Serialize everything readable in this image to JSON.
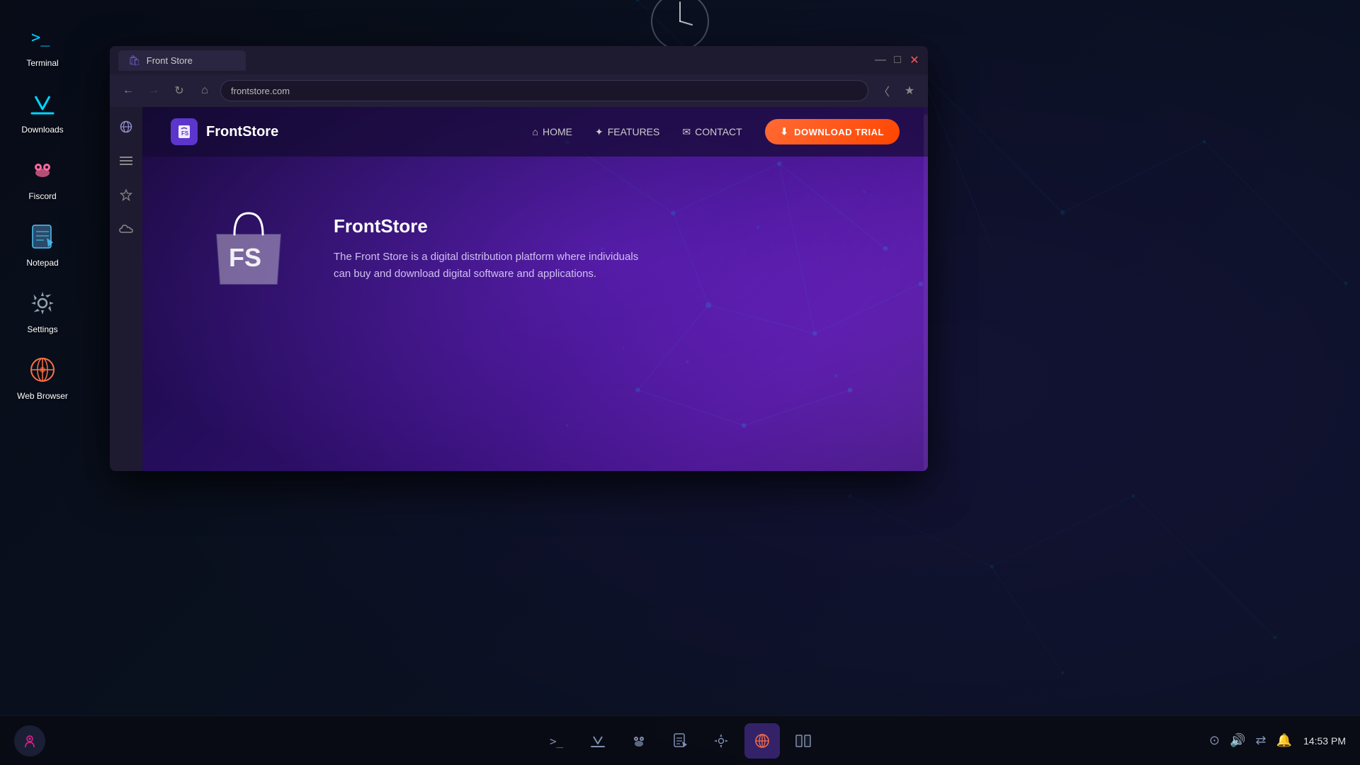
{
  "desktop": {
    "background": "#0d1117"
  },
  "sidebar_icons": [
    {
      "id": "terminal",
      "label": "Terminal",
      "icon": ">_",
      "color": "#00d4ff"
    },
    {
      "id": "downloads",
      "label": "Downloads",
      "icon": "⬇",
      "color": "#00d4ff"
    },
    {
      "id": "fiscord",
      "label": "Fiscord",
      "icon": "👾",
      "color": "#ff6b9d"
    },
    {
      "id": "notepad",
      "label": "Notepad",
      "icon": "📝",
      "color": "#4fc3f7"
    },
    {
      "id": "settings",
      "label": "Settings",
      "icon": "⚙",
      "color": "#90a4ae"
    },
    {
      "id": "web_browser",
      "label": "Web Browser",
      "icon": "🌐",
      "color": "#ff7043"
    }
  ],
  "taskbar": {
    "left_icon": "🎙",
    "apps": [
      {
        "id": "terminal",
        "icon": ">_",
        "active": false
      },
      {
        "id": "downloads",
        "icon": "⬇",
        "active": false
      },
      {
        "id": "fiscord",
        "icon": "👾",
        "active": false
      },
      {
        "id": "notepad",
        "icon": "📋",
        "active": false
      },
      {
        "id": "settings",
        "icon": "⚙",
        "active": false
      },
      {
        "id": "browser",
        "icon": "🌐",
        "active": true
      },
      {
        "id": "windows",
        "icon": "▐▌",
        "active": false
      }
    ],
    "right_icons": [
      "⊙",
      "🔊",
      "⇄",
      "🔔"
    ],
    "time": "14:53 PM"
  },
  "browser": {
    "title": "Front Store",
    "tab_icon": "🛍",
    "url": "frontstore.com",
    "home_icon": "⌂",
    "sidebar_items": [
      "≡",
      "★",
      "☁"
    ]
  },
  "frontstore": {
    "logo_text": "FrontStore",
    "nav": {
      "home_label": "HOME",
      "features_label": "FEATURES",
      "contact_label": "CONTACT",
      "download_label": "DOWNLOAD TRIAL"
    },
    "hero": {
      "title": "FrontStore",
      "description": "The Front Store is a digital distribution platform where individuals can buy and download digital software and applications."
    }
  }
}
